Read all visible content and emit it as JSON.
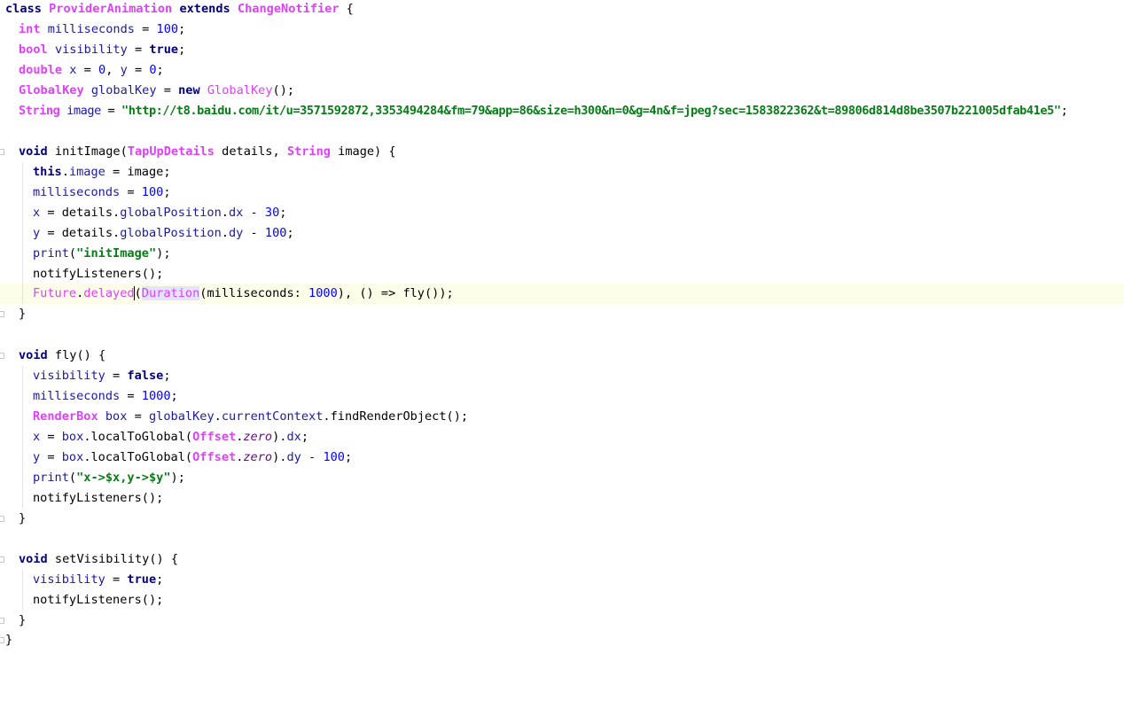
{
  "code": {
    "l1": [
      "class",
      " ",
      "ProviderAnimation",
      " ",
      "extends",
      " ",
      "ChangeNotifier",
      " {"
    ],
    "l2": [
      "int",
      " ",
      "milliseconds",
      " = ",
      "100",
      ";"
    ],
    "l3": [
      "bool",
      " ",
      "visibility",
      " = ",
      "true",
      ";"
    ],
    "l4": [
      "double",
      " ",
      "x",
      " = ",
      "0",
      ", ",
      "y",
      " = ",
      "0",
      ";"
    ],
    "l5": [
      "GlobalKey",
      " ",
      "globalKey",
      " = ",
      "new",
      " ",
      "GlobalKey",
      "();"
    ],
    "l6": [
      "String",
      " ",
      "image",
      " = ",
      "\"http://t8.baidu.com/it/u=3571592872,3353494284&fm=79&app=86&size=h300&n=0&g=4n&f=jpeg?sec=1583822362&t=89806d814d8be3507b221005dfab41e5\"",
      ";"
    ],
    "l8": [
      "void",
      " initImage(",
      "TapUpDetails",
      " details, ",
      "String",
      " image) {"
    ],
    "l9": [
      "this",
      ".",
      "image",
      " = image;"
    ],
    "l10": [
      "milliseconds",
      " = ",
      "100",
      ";"
    ],
    "l11": [
      "x",
      " = details.",
      "globalPosition",
      ".",
      "dx",
      " - ",
      "30",
      ";"
    ],
    "l12": [
      "y",
      " = details.",
      "globalPosition",
      ".",
      "dy",
      " - ",
      "100",
      ";"
    ],
    "l13": [
      "print",
      "(",
      "\"initImage\"",
      ");"
    ],
    "l14": [
      "notifyListeners();"
    ],
    "l15": [
      "Future",
      ".",
      "delayed",
      "(",
      "Duration",
      "(milliseconds: ",
      "1000",
      "), () => fly());"
    ],
    "l16": [
      "}"
    ],
    "l18": [
      "void",
      " fly() {"
    ],
    "l19": [
      "visibility",
      " = ",
      "false",
      ";"
    ],
    "l20": [
      "milliseconds",
      " = ",
      "1000",
      ";"
    ],
    "l21": [
      "RenderBox",
      " ",
      "box",
      " = ",
      "globalKey",
      ".",
      "currentContext",
      ".findRenderObject();"
    ],
    "l22": [
      "x",
      " = ",
      "box",
      ".localToGlobal(",
      "Offset",
      ".",
      "zero",
      ").",
      "dx",
      ";"
    ],
    "l23": [
      "y",
      " = ",
      "box",
      ".localToGlobal(",
      "Offset",
      ".",
      "zero",
      ").",
      "dy",
      " - ",
      "100",
      ";"
    ],
    "l24": [
      "print",
      "(",
      "\"x->$x,y->$y\"",
      ");"
    ],
    "l25": [
      "notifyListeners();"
    ],
    "l26": [
      "}"
    ],
    "l28": [
      "void",
      " setVisibility() {"
    ],
    "l29": [
      "visibility",
      " = ",
      "true",
      ";"
    ],
    "l30": [
      "notifyListeners();"
    ],
    "l31": [
      "}"
    ],
    "l32": [
      "}"
    ]
  },
  "colors": {
    "keyword": "#000080",
    "type": "#e040fb",
    "field": "#1a1aa6",
    "number": "#0000ff",
    "string": "#067d17",
    "current_line": "#fdfce9"
  }
}
